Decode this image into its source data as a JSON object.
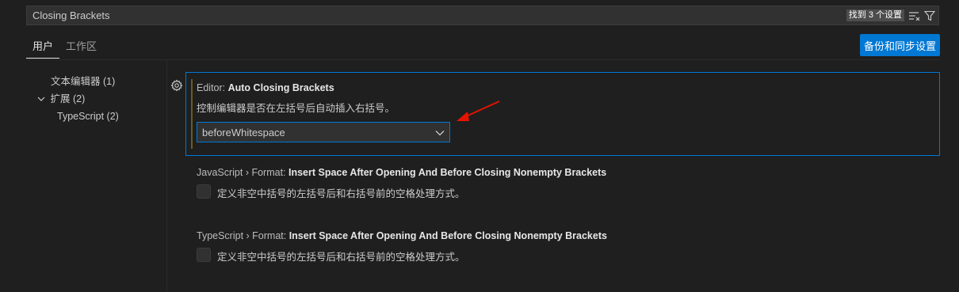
{
  "search": {
    "value": "Closing Brackets",
    "result_count": "找到 3 个设置"
  },
  "tabs": [
    {
      "label": "用户",
      "active": true
    },
    {
      "label": "工作区",
      "active": false
    }
  ],
  "sync_button_label": "备份和同步设置",
  "toc": [
    {
      "label": "文本编辑器",
      "count": "(1)"
    },
    {
      "label": "扩展",
      "count": "(2)",
      "expanded": true
    },
    {
      "label": "TypeScript",
      "count": "(2)"
    }
  ],
  "settings": [
    {
      "category": "Editor: ",
      "name": "Auto Closing Brackets",
      "description": "控制编辑器是否在左括号后自动插入右括号。",
      "value": "beforeWhitespace"
    },
    {
      "category": "JavaScript › Format: ",
      "name": "Insert Space After Opening And Before Closing Nonempty Brackets",
      "description": "定义非空中括号的左括号后和右括号前的空格处理方式。",
      "checked": false
    },
    {
      "category": "TypeScript › Format: ",
      "name": "Insert Space After Opening And Before Closing Nonempty Brackets",
      "description": "定义非空中括号的左括号后和右括号前的空格处理方式。",
      "checked": false
    }
  ],
  "colors": {
    "accent": "#0078d4",
    "annotation_arrow": "#e51400",
    "background": "#1f1f1f"
  }
}
